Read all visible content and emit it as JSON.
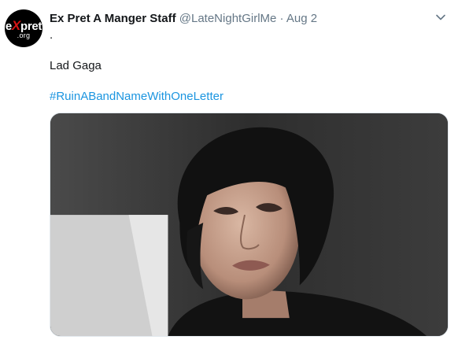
{
  "author": {
    "display_name": "Ex Pret A Manger Staff",
    "handle": "@LateNightGirlMe",
    "separator": "·",
    "date": "Aug 2",
    "avatar": {
      "logo_prefix": "e",
      "logo_mark": "X",
      "logo_suffix": "pret",
      "logo_sub": ".org"
    }
  },
  "tweet": {
    "first_line": ".",
    "text": "Lad Gaga",
    "hashtag": "#RuinABandNameWithOneLetter"
  },
  "media": {
    "description_icon": "photo-icon"
  },
  "icons": {
    "menu": "chevron-down-icon"
  },
  "colors": {
    "link": "#1b95e0",
    "secondary_text": "#657786",
    "primary_text": "#14171a",
    "avatar_mark": "#d51414"
  }
}
